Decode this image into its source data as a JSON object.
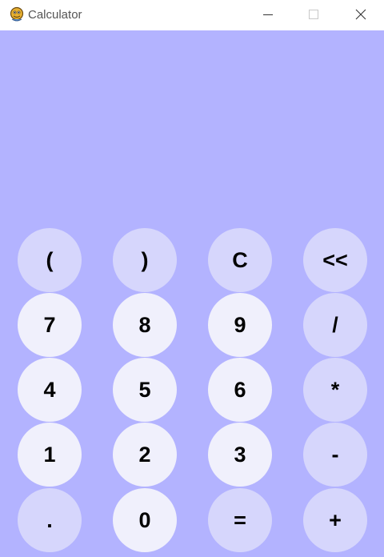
{
  "window": {
    "title": "Calculator",
    "icon": "python-snake-icon"
  },
  "display": {
    "value": ""
  },
  "keypad": {
    "rows": [
      [
        "(",
        ")",
        "C",
        "<<"
      ],
      [
        "7",
        "8",
        "9",
        "/"
      ],
      [
        "4",
        "5",
        "6",
        "*"
      ],
      [
        "1",
        "2",
        "3",
        "-"
      ],
      [
        ".",
        "0",
        "=",
        "+"
      ]
    ]
  },
  "colors": {
    "background": "#b3b3ff",
    "digit_key": "#f0f0fc",
    "function_key": "#d6d6fc",
    "text": "#000000"
  }
}
